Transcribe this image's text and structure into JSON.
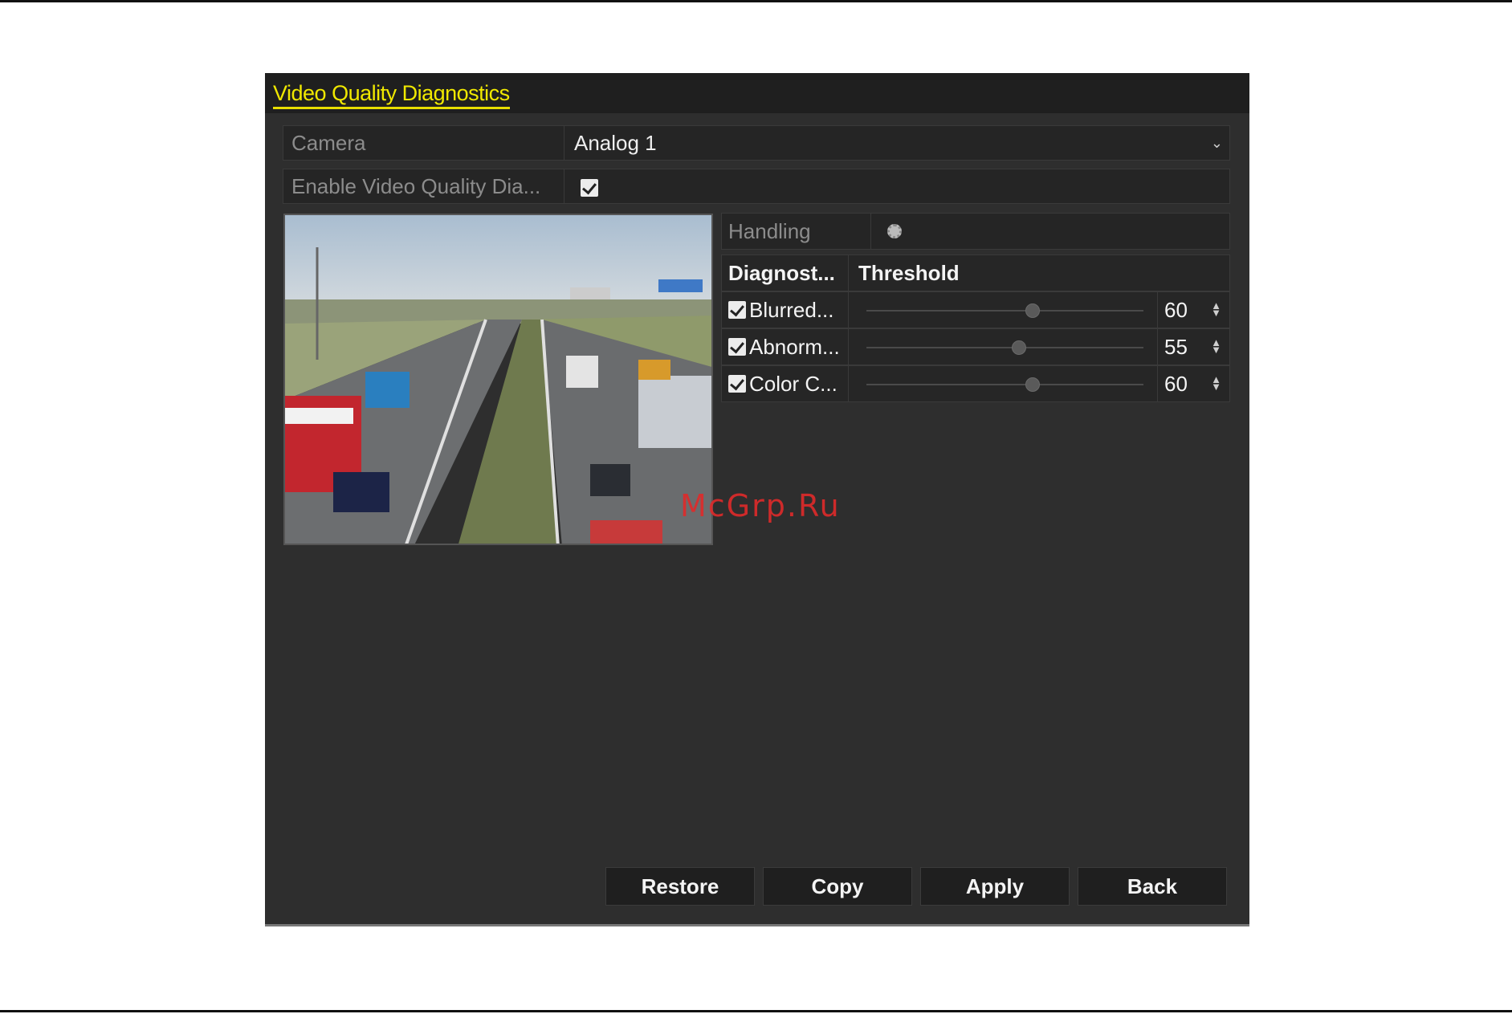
{
  "panel": {
    "title": "Video Quality Diagnostics"
  },
  "camera": {
    "label": "Camera",
    "value": "Analog 1"
  },
  "enable": {
    "label": "Enable Video Quality Dia...",
    "checked": true
  },
  "handling": {
    "label": "Handling"
  },
  "diagnostics": {
    "col_name": "Diagnost...",
    "col_threshold": "Threshold",
    "rows": [
      {
        "name": "Blurred...",
        "checked": true,
        "value": "60"
      },
      {
        "name": "Abnorm...",
        "checked": true,
        "value": "55"
      },
      {
        "name": "Color C...",
        "checked": true,
        "value": "60"
      }
    ]
  },
  "buttons": {
    "restore": "Restore",
    "copy": "Copy",
    "apply": "Apply",
    "back": "Back"
  },
  "watermark": "McGrp.Ru",
  "colors": {
    "title": "#f0e800",
    "panel_bg": "#2e2e2e",
    "watermark": "#e02a2a"
  }
}
